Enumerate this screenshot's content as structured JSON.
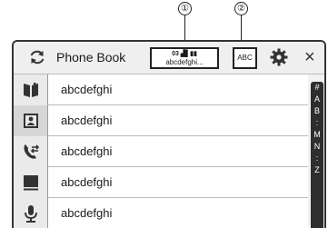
{
  "callouts": [
    "①",
    "②"
  ],
  "header": {
    "title": "Phone Book",
    "status_line1": "03 ▟▌▮▮",
    "status_line2": "abcdefghi...",
    "abc_label": "ABC",
    "close_label": "×"
  },
  "sidebar": {
    "items": [
      {
        "name": "phone-book-icon",
        "active": false
      },
      {
        "name": "contacts-icon",
        "active": true
      },
      {
        "name": "call-history-icon",
        "active": false
      },
      {
        "name": "preset-dial-icon",
        "active": false
      },
      {
        "name": "voice-recognition-icon",
        "active": false
      }
    ]
  },
  "list": {
    "items": [
      "abcdefghi",
      "abcdefghi",
      "abcdefghi",
      "abcdefghi",
      "abcdefghi"
    ]
  },
  "index_bar": [
    "#",
    "A",
    "B",
    ":",
    "M",
    "N",
    ":",
    "Z"
  ]
}
